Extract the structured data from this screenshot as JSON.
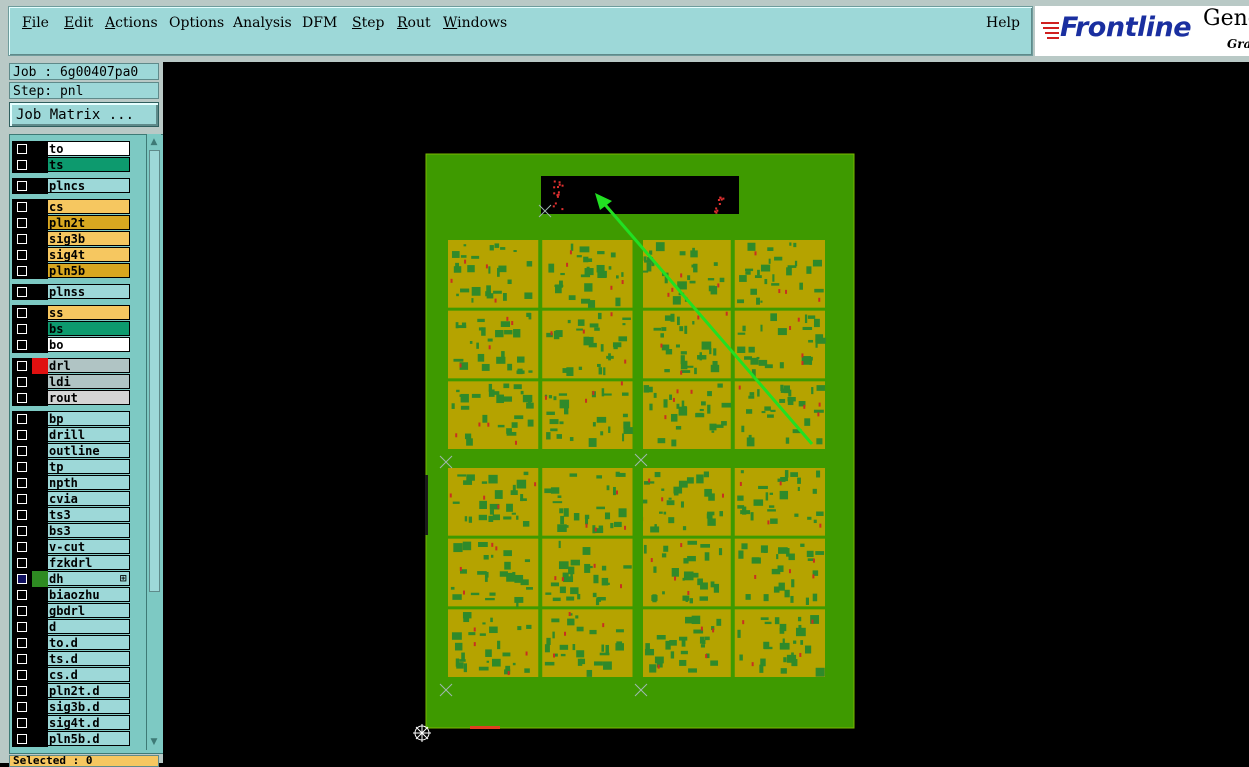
{
  "menu": {
    "items": [
      {
        "label": "File",
        "underline": true
      },
      {
        "label": "Edit",
        "underline": true
      },
      {
        "label": "Actions",
        "underline": true
      },
      {
        "label": "Options",
        "underline": false
      },
      {
        "label": "Analysis",
        "underline": false
      },
      {
        "label": "DFM",
        "underline": false
      },
      {
        "label": "Step",
        "underline": true
      },
      {
        "label": "Rout",
        "underline": true
      },
      {
        "label": "Windows",
        "underline": true
      }
    ],
    "help": "Help"
  },
  "logo": {
    "brand": "Frontline",
    "product": "Genes",
    "sub": "Gra"
  },
  "job": {
    "job_label": "Job : 6g00407pa0",
    "step_label": "Step: pnl",
    "job_matrix_button": "Job Matrix ..."
  },
  "layers": [
    {
      "name": "to",
      "color": "white"
    },
    {
      "name": "ts",
      "color": "green"
    },
    {
      "name": "plncs",
      "color": "cyan"
    },
    {
      "name": "cs",
      "color": "orange"
    },
    {
      "name": "pln2t",
      "color": "dorange"
    },
    {
      "name": "sig3b",
      "color": "orange"
    },
    {
      "name": "sig4t",
      "color": "orange"
    },
    {
      "name": "pln5b",
      "color": "dorange"
    },
    {
      "name": "plnss",
      "color": "cyan"
    },
    {
      "name": "ss",
      "color": "orange"
    },
    {
      "name": "bs",
      "color": "green"
    },
    {
      "name": "bo",
      "color": "white"
    },
    {
      "name": "drl",
      "color": "gray",
      "swatch": "#e01010"
    },
    {
      "name": "ldi",
      "color": "gray"
    },
    {
      "name": "rout",
      "color": "lgray"
    },
    {
      "name": "bp",
      "color": "cyan"
    },
    {
      "name": "drill",
      "color": "cyan"
    },
    {
      "name": "outline",
      "color": "cyan"
    },
    {
      "name": "tp",
      "color": "cyan"
    },
    {
      "name": "npth",
      "color": "cyan"
    },
    {
      "name": "cvia",
      "color": "cyan"
    },
    {
      "name": "ts3",
      "color": "cyan"
    },
    {
      "name": "bs3",
      "color": "cyan"
    },
    {
      "name": "v-cut",
      "color": "cyan"
    },
    {
      "name": "fzkdrl",
      "color": "cyan"
    },
    {
      "name": "dh",
      "color": "cyan",
      "swatch": "#2e8b22",
      "selected": true,
      "extra": "⊞"
    },
    {
      "name": "biaozhu",
      "color": "cyan"
    },
    {
      "name": "gbdrl",
      "color": "cyan"
    },
    {
      "name": "d",
      "color": "cyan"
    },
    {
      "name": "to.d",
      "color": "cyan"
    },
    {
      "name": "ts.d",
      "color": "cyan"
    },
    {
      "name": "cs.d",
      "color": "cyan"
    },
    {
      "name": "pln2t.d",
      "color": "cyan"
    },
    {
      "name": "sig3b.d",
      "color": "cyan"
    },
    {
      "name": "sig4t.d",
      "color": "cyan"
    },
    {
      "name": "pln5b.d",
      "color": "cyan"
    }
  ],
  "status": {
    "selected": "Selected : 0"
  },
  "colors": {
    "panel_green": "#3e9a00",
    "board_gold": "#b5a300",
    "trace_green": "#2f8a2a",
    "arrow": "#22e022",
    "ui_cyan": "#9dd8d8"
  }
}
